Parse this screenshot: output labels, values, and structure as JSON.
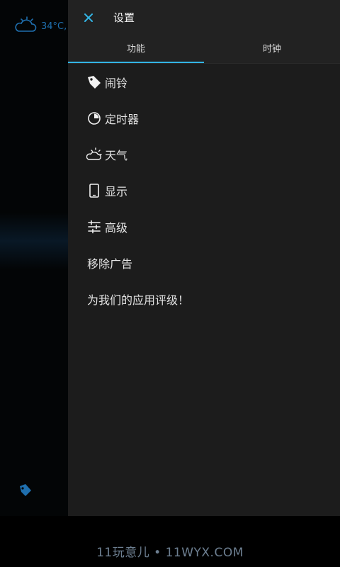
{
  "background": {
    "weather_temp": "34°C,"
  },
  "header": {
    "title": "设置"
  },
  "tabs": [
    {
      "label": "功能",
      "active": true
    },
    {
      "label": "时钟",
      "active": false
    }
  ],
  "menu": {
    "items": [
      {
        "label": "闹铃",
        "icon": "alarm-bell-icon"
      },
      {
        "label": "定时器",
        "icon": "timer-icon"
      },
      {
        "label": "天气",
        "icon": "weather-icon"
      },
      {
        "label": "显示",
        "icon": "display-phone-icon"
      },
      {
        "label": "高级",
        "icon": "sliders-icon"
      },
      {
        "label": "移除广告",
        "icon": ""
      },
      {
        "label": "为我们的应用评级！",
        "icon": ""
      }
    ]
  },
  "footer": {
    "watermark": "11玩意儿 • 11WYX.COM"
  },
  "colors": {
    "accent": "#33b5e5",
    "drawer_bg": "#1c1c1c",
    "bg_icon": "#1f6fae"
  }
}
